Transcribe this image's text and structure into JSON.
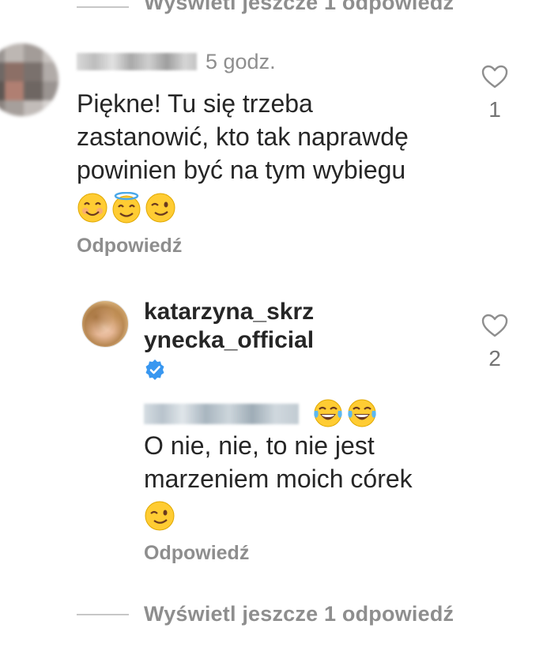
{
  "thread": {
    "view_more_top": "Wyświetl jeszcze 1 odpowiedź",
    "view_more_bottom": "Wyświetl jeszcze 1 odpowiedź"
  },
  "comment1": {
    "timestamp": "5 godz.",
    "text": "Piękne! Tu się trzeba\nzastanowić, kto tak naprawdę\npowinien być na tym wybiegu",
    "emojis": [
      "smiling-face-emoji",
      "halo-face-emoji",
      "winking-face-emoji"
    ],
    "like_count": "1",
    "reply_label": "Odpowiedź"
  },
  "comment2": {
    "username": "katarzyna_skrz\nynecka_official",
    "verified": true,
    "mention_emojis": [
      "tears-of-joy-emoji",
      "tears-of-joy-emoji"
    ],
    "text": "O nie, nie, to nie jest\nmarzeniem moich córek",
    "emojis": [
      "winking-face-emoji"
    ],
    "like_count": "2",
    "reply_label": "Odpowiedź"
  },
  "colors": {
    "text": "#262626",
    "secondary": "#8e8e8e",
    "verified_blue": "#3897f0",
    "divider": "#c7c7c7"
  }
}
